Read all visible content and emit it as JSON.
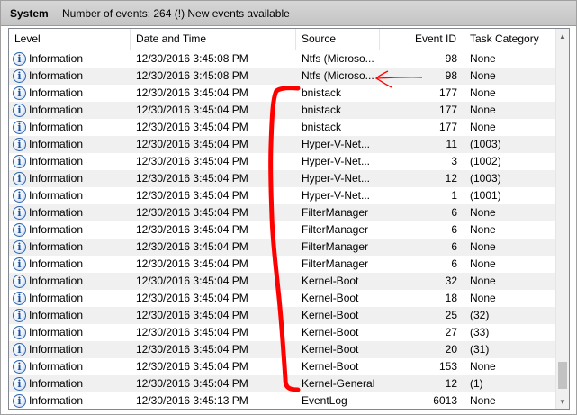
{
  "titlebar": {
    "log_name": "System",
    "event_count_text": "Number of events: 264 (!) New events available"
  },
  "columns": {
    "level": "Level",
    "date": "Date and Time",
    "source": "Source",
    "event_id": "Event ID",
    "task_category": "Task Category"
  },
  "icons": {
    "info": "information-icon",
    "info_glyph": "i"
  },
  "colors": {
    "annotation": "#ff0000",
    "row_alternate": "#f0f0f0",
    "info_icon_border": "#2a62b0"
  },
  "rows": [
    {
      "level": "Information",
      "date": "12/30/2016 3:45:08 PM",
      "source": "Ntfs (Microso...",
      "event_id": "98",
      "category": "None"
    },
    {
      "level": "Information",
      "date": "12/30/2016 3:45:08 PM",
      "source": "Ntfs (Microso...",
      "event_id": "98",
      "category": "None"
    },
    {
      "level": "Information",
      "date": "12/30/2016 3:45:04 PM",
      "source": "bnistack",
      "event_id": "177",
      "category": "None"
    },
    {
      "level": "Information",
      "date": "12/30/2016 3:45:04 PM",
      "source": "bnistack",
      "event_id": "177",
      "category": "None"
    },
    {
      "level": "Information",
      "date": "12/30/2016 3:45:04 PM",
      "source": "bnistack",
      "event_id": "177",
      "category": "None"
    },
    {
      "level": "Information",
      "date": "12/30/2016 3:45:04 PM",
      "source": "Hyper-V-Net...",
      "event_id": "11",
      "category": "(1003)"
    },
    {
      "level": "Information",
      "date": "12/30/2016 3:45:04 PM",
      "source": "Hyper-V-Net...",
      "event_id": "3",
      "category": "(1002)"
    },
    {
      "level": "Information",
      "date": "12/30/2016 3:45:04 PM",
      "source": "Hyper-V-Net...",
      "event_id": "12",
      "category": "(1003)"
    },
    {
      "level": "Information",
      "date": "12/30/2016 3:45:04 PM",
      "source": "Hyper-V-Net...",
      "event_id": "1",
      "category": "(1001)"
    },
    {
      "level": "Information",
      "date": "12/30/2016 3:45:04 PM",
      "source": "FilterManager",
      "event_id": "6",
      "category": "None"
    },
    {
      "level": "Information",
      "date": "12/30/2016 3:45:04 PM",
      "source": "FilterManager",
      "event_id": "6",
      "category": "None"
    },
    {
      "level": "Information",
      "date": "12/30/2016 3:45:04 PM",
      "source": "FilterManager",
      "event_id": "6",
      "category": "None"
    },
    {
      "level": "Information",
      "date": "12/30/2016 3:45:04 PM",
      "source": "FilterManager",
      "event_id": "6",
      "category": "None"
    },
    {
      "level": "Information",
      "date": "12/30/2016 3:45:04 PM",
      "source": "Kernel-Boot",
      "event_id": "32",
      "category": "None"
    },
    {
      "level": "Information",
      "date": "12/30/2016 3:45:04 PM",
      "source": "Kernel-Boot",
      "event_id": "18",
      "category": "None"
    },
    {
      "level": "Information",
      "date": "12/30/2016 3:45:04 PM",
      "source": "Kernel-Boot",
      "event_id": "25",
      "category": "(32)"
    },
    {
      "level": "Information",
      "date": "12/30/2016 3:45:04 PM",
      "source": "Kernel-Boot",
      "event_id": "27",
      "category": "(33)"
    },
    {
      "level": "Information",
      "date": "12/30/2016 3:45:04 PM",
      "source": "Kernel-Boot",
      "event_id": "20",
      "category": "(31)"
    },
    {
      "level": "Information",
      "date": "12/30/2016 3:45:04 PM",
      "source": "Kernel-Boot",
      "event_id": "153",
      "category": "None"
    },
    {
      "level": "Information",
      "date": "12/30/2016 3:45:04 PM",
      "source": "Kernel-General",
      "event_id": "12",
      "category": "(1)"
    },
    {
      "level": "Information",
      "date": "12/30/2016 3:45:13 PM",
      "source": "EventLog",
      "event_id": "6013",
      "category": "None"
    }
  ]
}
